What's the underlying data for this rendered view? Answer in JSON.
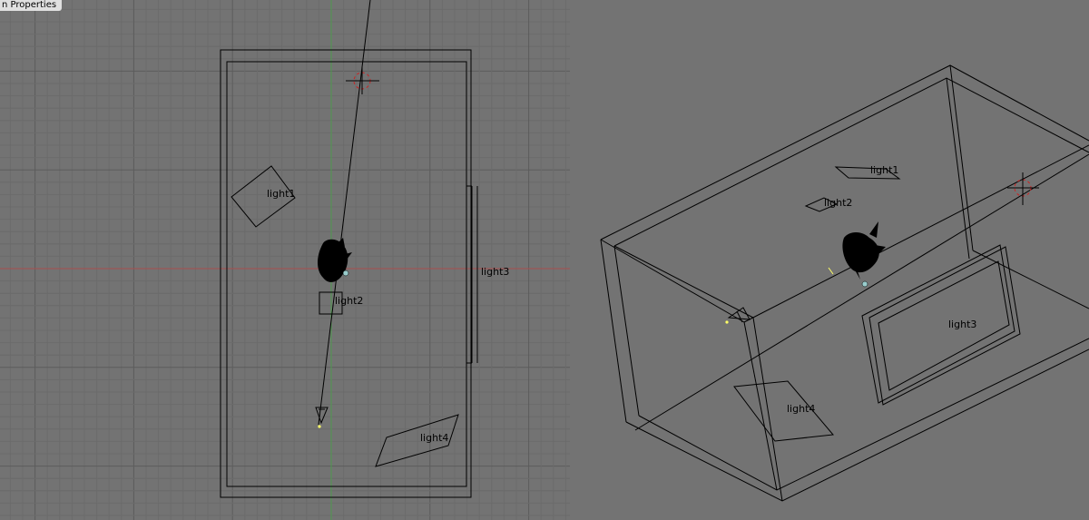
{
  "header": {
    "properties_tab_label": "n Properties"
  },
  "scene": {
    "lights": {
      "light1": "light1",
      "light2": "light2",
      "light3": "light3",
      "light4": "light4"
    }
  },
  "colors": {
    "background": "#737373",
    "x_axis": "#a94e4e",
    "y_axis": "#4e9a4e",
    "target_marker": "#cc2222",
    "selection_dot": "#ffff66"
  }
}
